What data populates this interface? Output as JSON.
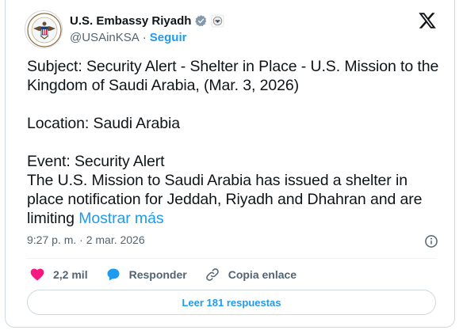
{
  "author": {
    "display_name": "U.S. Embassy Riyadh",
    "handle": "@USAinKSA",
    "separator": "·",
    "follow_label": "Seguir",
    "avatar_icon": "us-embassy-seal-icon",
    "verified_icon": "gray-verified-badge-icon",
    "affiliation_icon": "government-seal-icon"
  },
  "platform_icon": "x-logo-icon",
  "post": {
    "paragraphs": [
      "Subject: Security Alert - Shelter in Place - U.S. Mission to the Kingdom of Saudi Arabia, (Mar. 3, 2026)",
      "Location: Saudi Arabia",
      "Event: Security Alert"
    ],
    "last_text": "The U.S. Mission to Saudi Arabia has issued a shelter in place notification for Jeddah, Riyadh and Dhahran and are limiting",
    "more_label": "Mostrar más"
  },
  "meta": {
    "timestamp": "9:27 p. m. · 2 mar. 2026",
    "info_icon": "info-icon"
  },
  "actions": {
    "like_count": "2,2 mil",
    "reply_label": "Responder",
    "copy_label": "Copia enlace"
  },
  "read_replies_label": "Leer 181 respuestas",
  "colors": {
    "accent": "#1d9bf0",
    "like": "#f91880",
    "text": "#0f1419",
    "muted": "#536471",
    "border": "#cfd9de"
  }
}
